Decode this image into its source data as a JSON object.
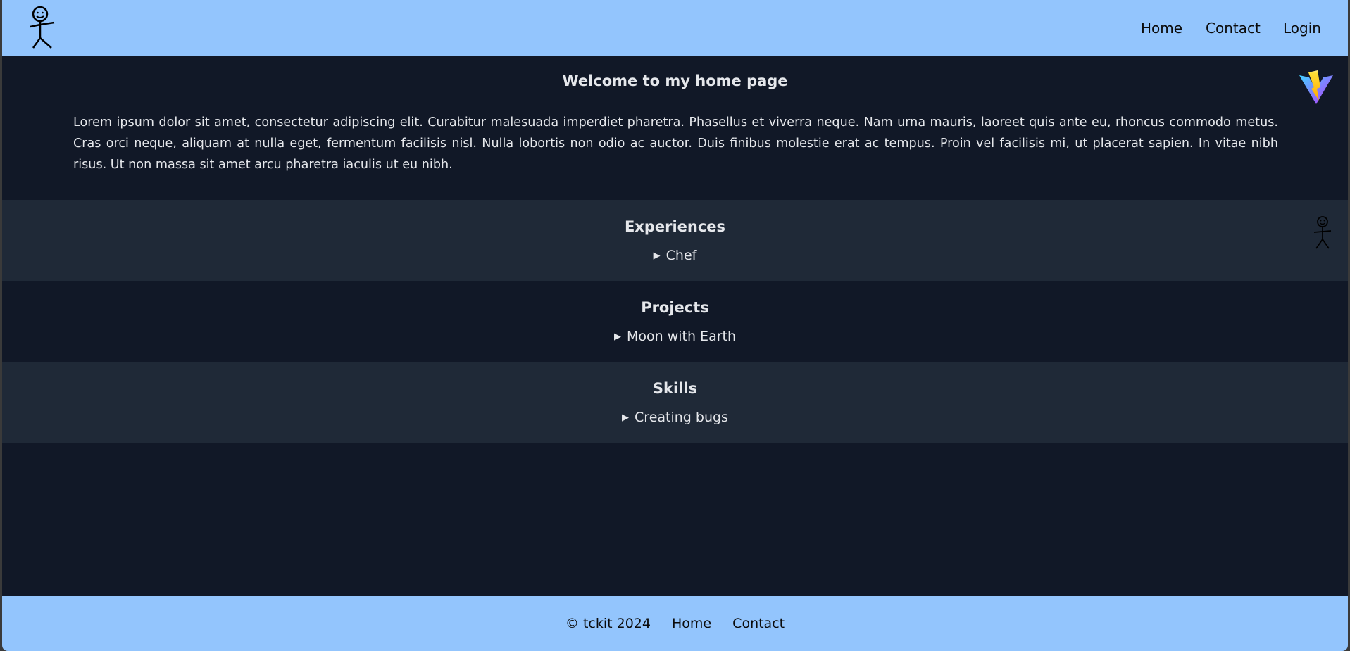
{
  "header": {
    "logo_icon": "stick-figure-icon",
    "nav": {
      "home": "Home",
      "contact": "Contact",
      "login": "Login"
    },
    "background": "#93c5fd"
  },
  "hero": {
    "title": "Welcome to my home page",
    "body": "Lorem ipsum dolor sit amet, consectetur adipiscing elit. Curabitur malesuada imperdiet pharetra. Phasellus et viverra neque. Nam urna mauris, laoreet quis ante eu, rhoncus commodo metus. Cras orci neque, aliquam at nulla eget, fermentum facilisis nisl. Nulla lobortis non odio ac auctor. Duis finibus molestie erat ac tempus. Proin vel facilisis mi, ut placerat sapien. In vitae nibh risus. Ut non massa sit amet arcu pharetra iaculis ut eu nibh.",
    "badge_icon": "vite-logo-icon"
  },
  "sections": {
    "experiences": {
      "title": "Experiences",
      "item": "Chef",
      "icon": "stick-figure-icon"
    },
    "projects": {
      "title": "Projects",
      "item": "Moon with Earth"
    },
    "skills": {
      "title": "Skills",
      "item": "Creating bugs"
    }
  },
  "footer": {
    "copyright": "© tckit 2024",
    "home": "Home",
    "contact": "Contact"
  },
  "colors": {
    "page_bg": "#111827",
    "alt_section_bg": "#1f2937",
    "bar_bg": "#93c5fd",
    "text": "#e5e7eb"
  }
}
